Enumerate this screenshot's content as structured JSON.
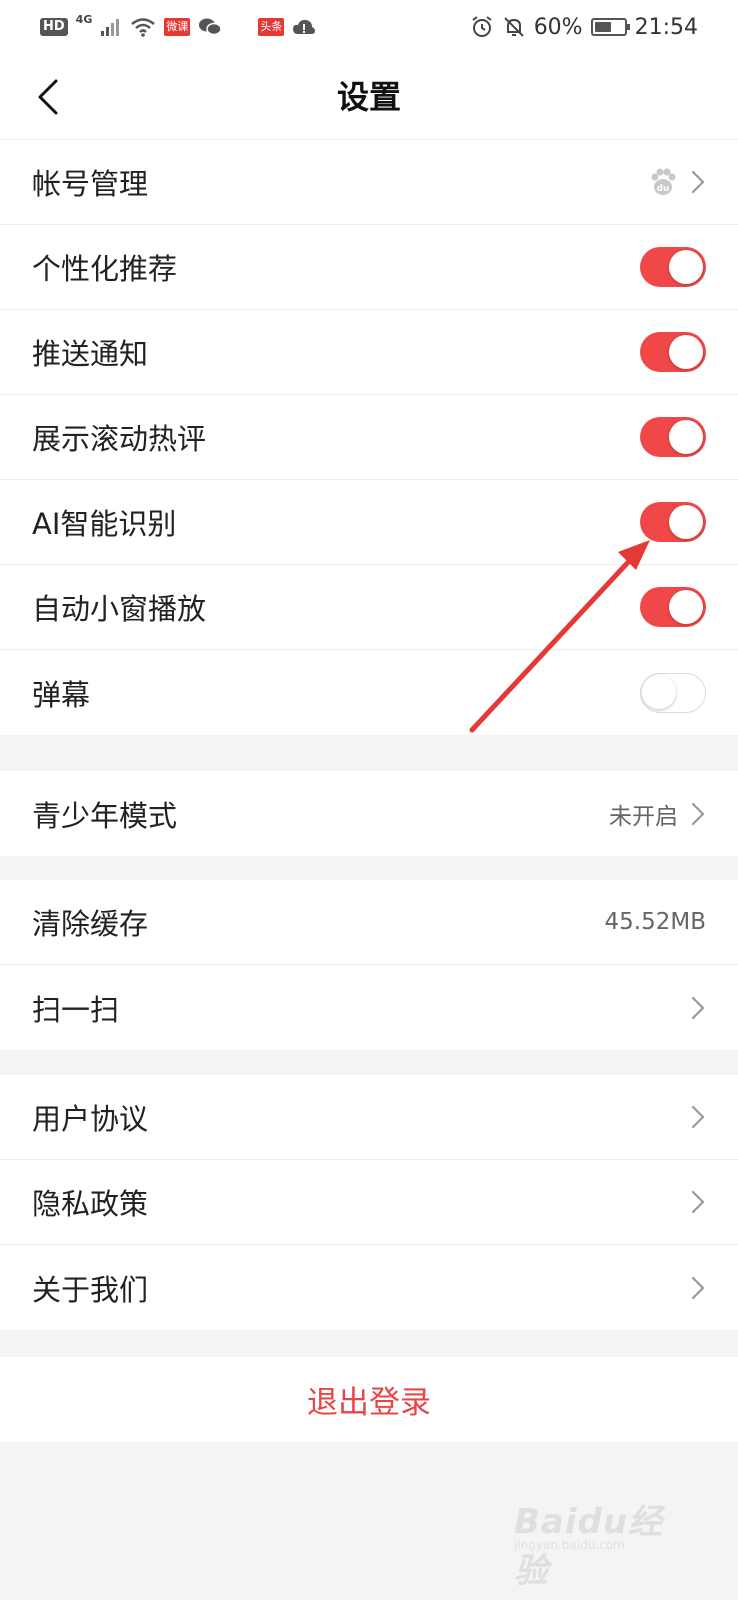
{
  "status_bar": {
    "hd": "HD",
    "network": "4G",
    "app1": "微课",
    "app2": "头条",
    "battery_text": "60%",
    "battery_level": 0.6,
    "time": "21:54"
  },
  "header": {
    "title": "设置"
  },
  "group1": [
    {
      "label": "帐号管理",
      "type": "link",
      "icon": "baidu-paw-icon"
    },
    {
      "label": "个性化推荐",
      "type": "toggle",
      "on": true
    },
    {
      "label": "推送通知",
      "type": "toggle",
      "on": true
    },
    {
      "label": "展示滚动热评",
      "type": "toggle",
      "on": true
    },
    {
      "label": "AI智能识别",
      "type": "toggle",
      "on": true
    },
    {
      "label": "自动小窗播放",
      "type": "toggle",
      "on": true
    },
    {
      "label": "弹幕",
      "type": "toggle",
      "on": false
    }
  ],
  "group2": [
    {
      "label": "青少年模式",
      "value": "未开启",
      "type": "link"
    }
  ],
  "group3": [
    {
      "label": "清除缓存",
      "value": "45.52MB",
      "type": "value"
    },
    {
      "label": "扫一扫",
      "type": "link"
    }
  ],
  "group4": [
    {
      "label": "用户协议",
      "type": "link"
    },
    {
      "label": "隐私政策",
      "type": "link"
    },
    {
      "label": "关于我们",
      "type": "link"
    }
  ],
  "logout": {
    "label": "退出登录"
  },
  "colors": {
    "accent": "#f04848",
    "logout": "#e84646",
    "annotation_arrow": "#e53935"
  },
  "watermark": {
    "brand": "Baidu经验",
    "url": "jingyan.baidu.com"
  }
}
